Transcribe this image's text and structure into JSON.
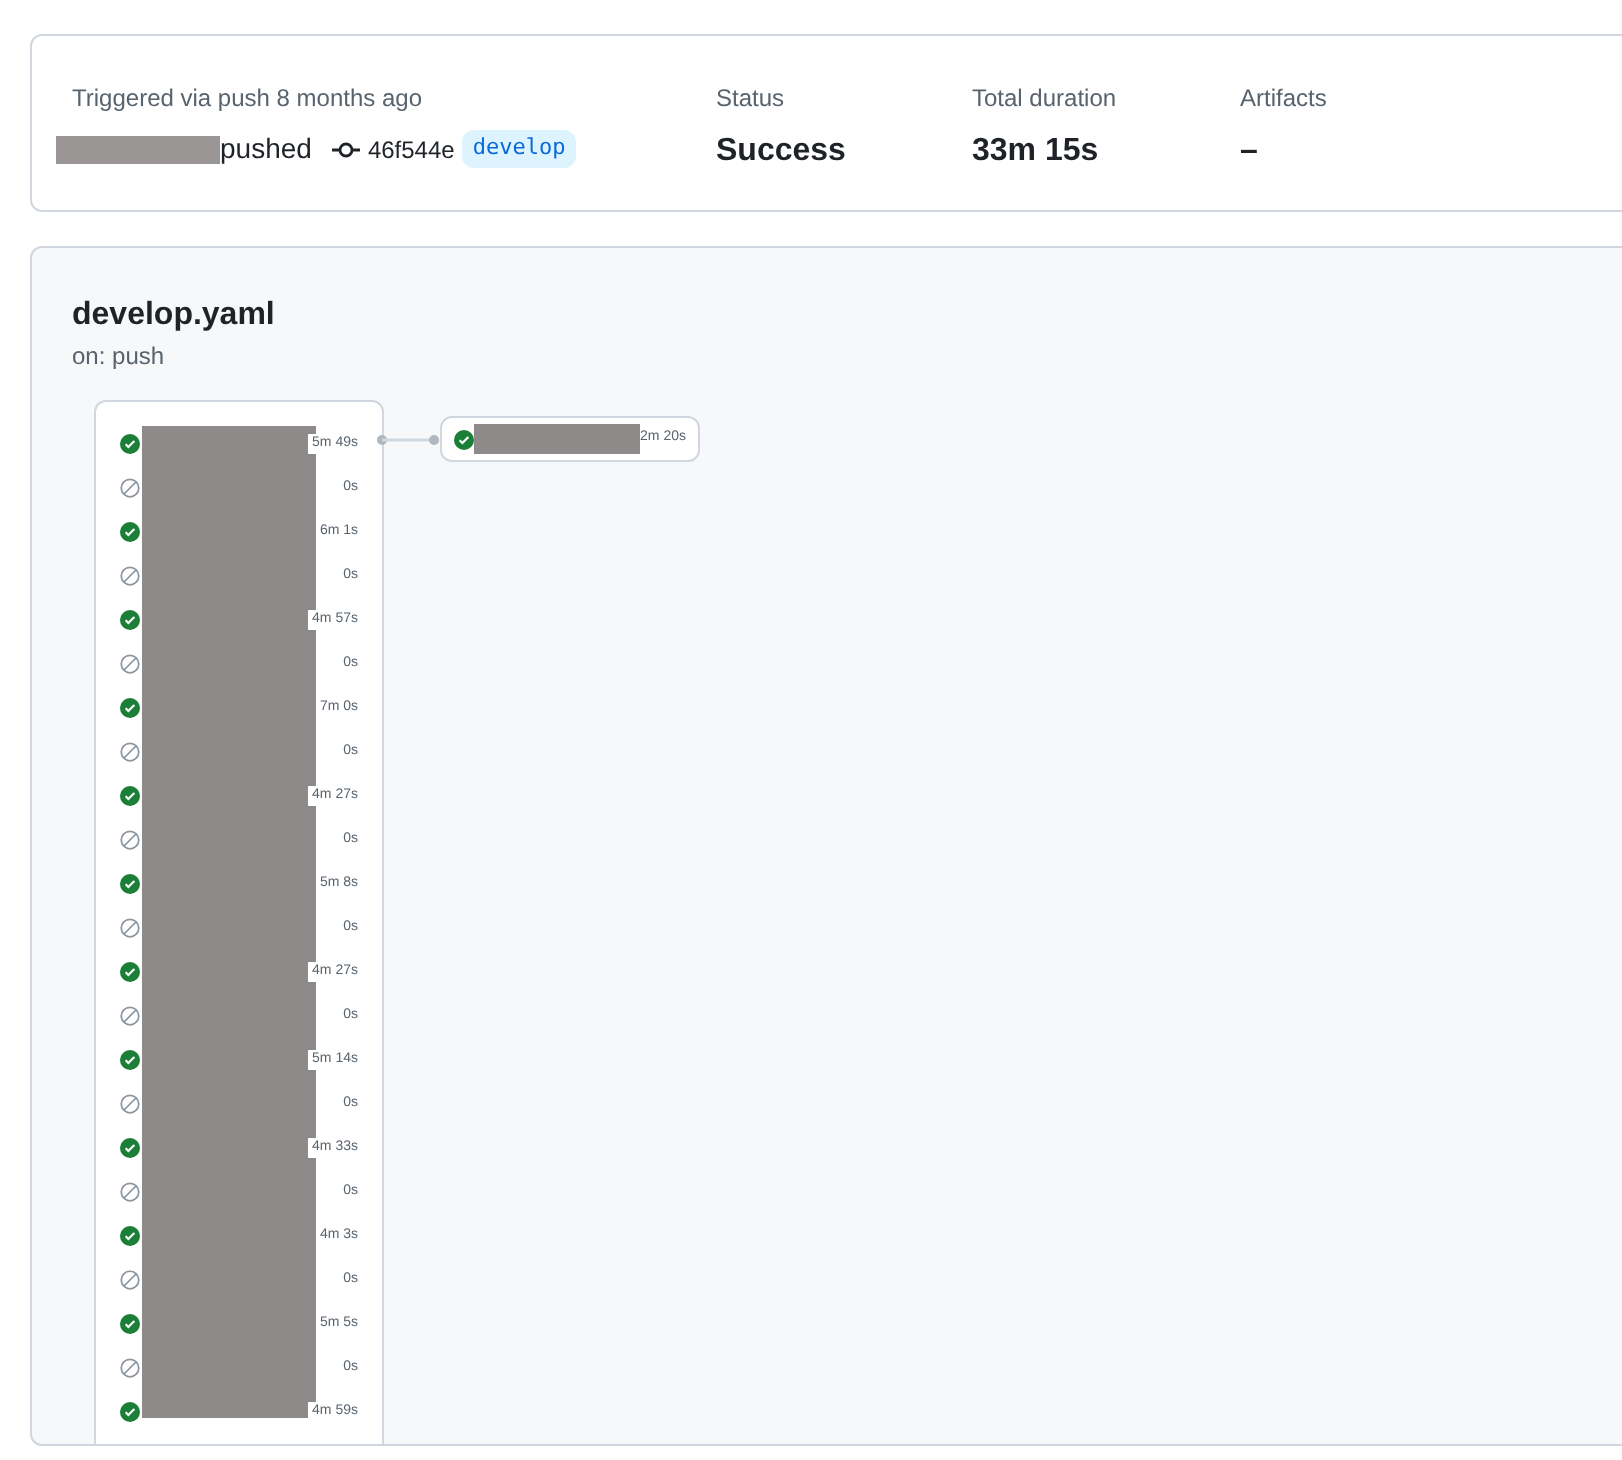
{
  "summary": {
    "trigger_text": "Triggered via push 8 months ago",
    "actor_action": "pushed",
    "commit": "46f544e",
    "branch": "develop",
    "stats": [
      {
        "label": "Status",
        "value": "Success"
      },
      {
        "label": "Total duration",
        "value": "33m 15s"
      },
      {
        "label": "Artifacts",
        "value": "–"
      }
    ]
  },
  "workflow": {
    "file": "develop.yaml",
    "trigger": "on: push",
    "jobs": [
      {
        "kind": "success",
        "duration": "5m 49s"
      },
      {
        "kind": "skipped",
        "duration": "0s"
      },
      {
        "kind": "success",
        "duration": "6m 1s"
      },
      {
        "kind": "skipped",
        "duration": "0s"
      },
      {
        "kind": "success",
        "duration": "4m 57s"
      },
      {
        "kind": "skipped",
        "duration": "0s"
      },
      {
        "kind": "success",
        "duration": "7m 0s"
      },
      {
        "kind": "skipped",
        "duration": "0s"
      },
      {
        "kind": "success",
        "duration": "4m 27s"
      },
      {
        "kind": "skipped",
        "duration": "0s"
      },
      {
        "kind": "success",
        "duration": "5m 8s"
      },
      {
        "kind": "skipped",
        "duration": "0s"
      },
      {
        "kind": "success",
        "duration": "4m 27s"
      },
      {
        "kind": "skipped",
        "duration": "0s"
      },
      {
        "kind": "success",
        "duration": "5m 14s"
      },
      {
        "kind": "skipped",
        "duration": "0s"
      },
      {
        "kind": "success",
        "duration": "4m 33s"
      },
      {
        "kind": "skipped",
        "duration": "0s"
      },
      {
        "kind": "success",
        "duration": "4m 3s"
      },
      {
        "kind": "skipped",
        "duration": "0s"
      },
      {
        "kind": "success",
        "duration": "5m 5s"
      },
      {
        "kind": "skipped",
        "duration": "0s"
      },
      {
        "kind": "success",
        "duration": "4m 59s"
      }
    ],
    "next_job": {
      "kind": "success",
      "duration": "2m 20s"
    }
  }
}
